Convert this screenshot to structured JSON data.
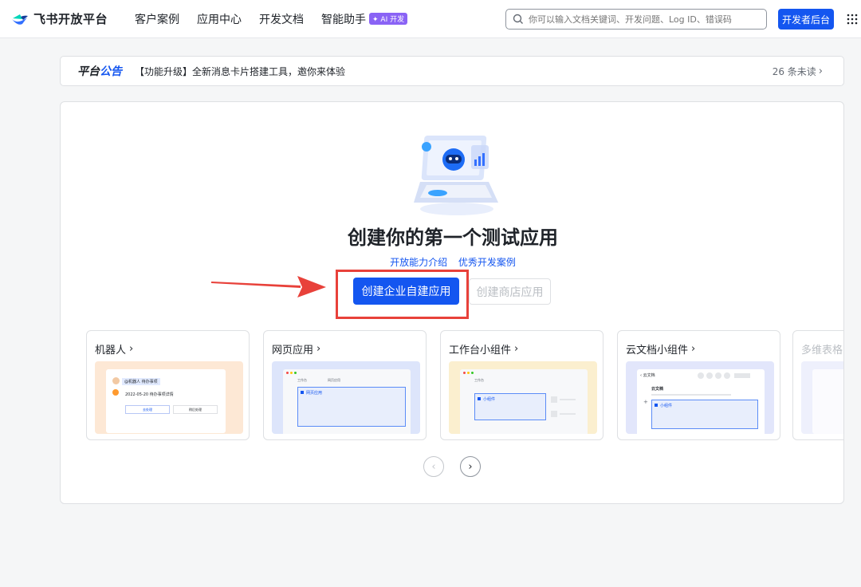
{
  "brand": {
    "name": "飞书开放平台"
  },
  "nav": {
    "items": [
      "客户案例",
      "应用中心",
      "开发文档",
      "智能助手"
    ],
    "ai_badge": "✦ AI 开发"
  },
  "search": {
    "placeholder": "你可以输入文档关键词、开发问题、Log ID、错误码"
  },
  "console_button": "开发者后台",
  "announcement": {
    "tag_part1": "平台",
    "tag_part2": "公告",
    "text": "【功能升级】全新消息卡片搭建工具，邀你来体验",
    "unread": "26 条未读"
  },
  "main": {
    "title": "创建你的第一个测试应用",
    "links": [
      "开放能力介绍",
      "优秀开发案例"
    ],
    "primary_button": "创建企业自建应用",
    "secondary_button": "创建商店应用"
  },
  "cards": [
    {
      "title": "机器人",
      "preview": {
        "sender": "@机器人 待办事项",
        "line": "2022-05-20 待办事项详情",
        "btn1": "去处理",
        "btn2": "稍后处理"
      }
    },
    {
      "title": "网页应用",
      "preview": {
        "tab1": "工作台",
        "tab2": "网页应用",
        "panel": "网页应用"
      }
    },
    {
      "title": "工作台小组件",
      "preview": {
        "tab1": "工作台",
        "panel": "小组件"
      }
    },
    {
      "title": "云文档小组件",
      "preview": {
        "doc": "云文档",
        "heading": "云文档",
        "panel": "小组件"
      }
    },
    {
      "title": "多维表格"
    }
  ],
  "colors": {
    "primary": "#1456f0",
    "highlight": "#e8413a",
    "robot_bg": "#fde8d5",
    "web_bg": "#dde5fb",
    "widget_bg": "#fbefcf",
    "doc_bg": "#e2e6fb"
  }
}
